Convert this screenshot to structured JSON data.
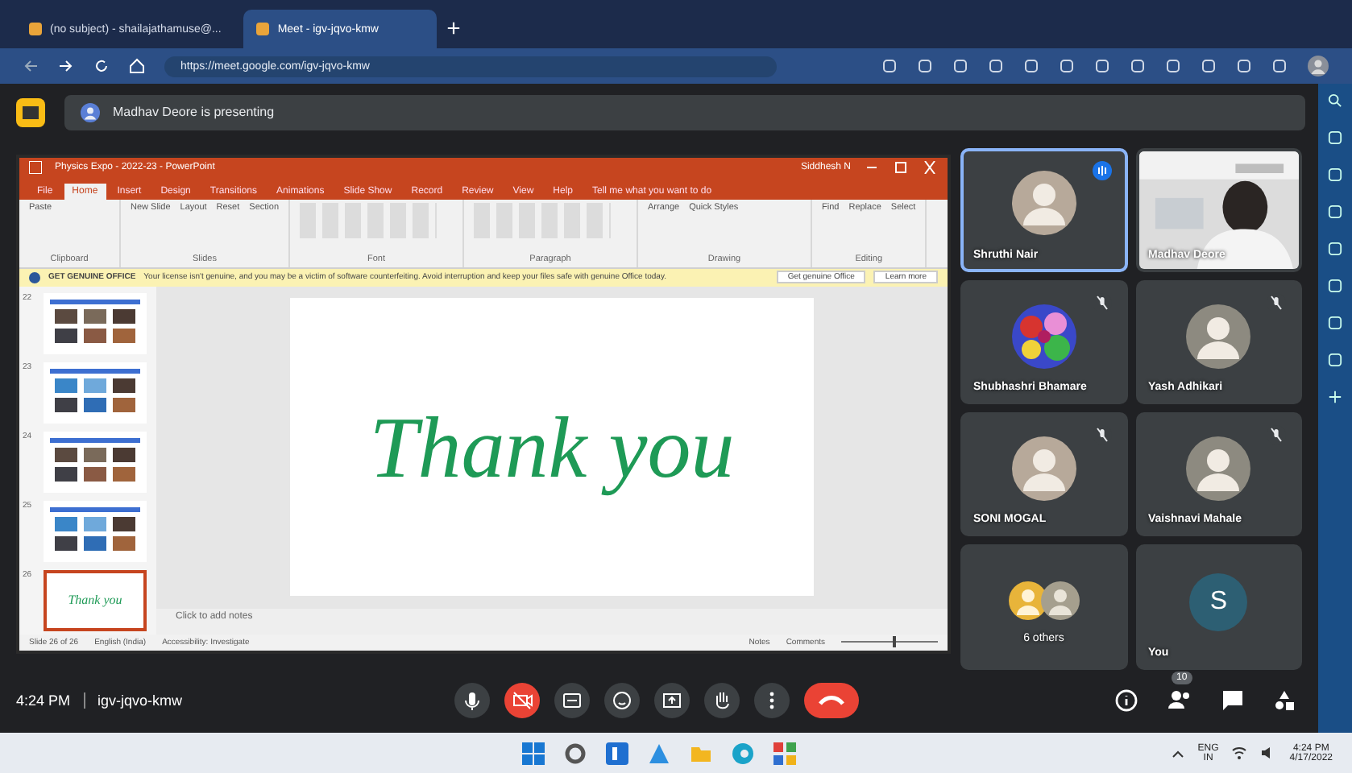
{
  "browser": {
    "tabs": [
      {
        "title": "(no subject) - shailajathamuse@...",
        "selected": false
      },
      {
        "title": "Meet - igv-jqvo-kmw",
        "selected": true
      }
    ],
    "url": "https://meet.google.com/igv-jqvo-kmw"
  },
  "meet": {
    "presenting_banner": "Madhav Deore is presenting",
    "presentation": {
      "title": "Physics Expo - 2022-23 - PowerPoint",
      "account": "Siddhesh N",
      "ribbon_tabs": [
        {
          "label": "File",
          "selected": false
        },
        {
          "label": "Home",
          "selected": true
        },
        {
          "label": "Insert",
          "selected": false
        },
        {
          "label": "Design",
          "selected": false
        },
        {
          "label": "Transitions",
          "selected": false
        },
        {
          "label": "Animations",
          "selected": false
        },
        {
          "label": "Slide Show",
          "selected": false
        },
        {
          "label": "Record",
          "selected": false
        },
        {
          "label": "Review",
          "selected": false
        },
        {
          "label": "View",
          "selected": false
        },
        {
          "label": "Help",
          "selected": false
        }
      ],
      "tell_me": "Tell me what you want to do",
      "ribbon_groups": [
        {
          "label": "Clipboard",
          "commands": [
            "Paste"
          ]
        },
        {
          "label": "Slides",
          "commands": [
            "New Slide",
            "Layout",
            "Reset",
            "Section"
          ]
        },
        {
          "label": "Font"
        },
        {
          "label": "Paragraph"
        },
        {
          "label": "Drawing",
          "commands": [
            "Arrange",
            "Quick Styles"
          ]
        },
        {
          "label": "Editing",
          "commands": [
            "Find",
            "Replace",
            "Select"
          ]
        }
      ],
      "notice": {
        "title": "GET GENUINE OFFICE",
        "message": "Your license isn't genuine, and you may be a victim of software counterfeiting. Avoid interruption and keep your files safe with genuine Office today.",
        "buttons": [
          "Get genuine Office",
          "Learn more"
        ]
      },
      "thumbnails": [
        {
          "number": "22",
          "kind": "picture",
          "selected": false
        },
        {
          "number": "23",
          "kind": "picture",
          "selected": false
        },
        {
          "number": "24",
          "kind": "picture",
          "selected": false
        },
        {
          "number": "25",
          "kind": "picture",
          "selected": false
        },
        {
          "number": "26",
          "kind": "text",
          "text": "Thank you",
          "selected": true
        }
      ],
      "slide_text": "Thank you",
      "notes_placeholder": "Click to add notes",
      "status_left": [
        "Slide 26 of 26",
        "English (India)",
        "Accessibility: Investigate"
      ],
      "status_right": [
        "Notes",
        "Comments"
      ],
      "zoom_slider": {
        "level": 0.55
      }
    },
    "participants": [
      {
        "name": "Shruthi Nair",
        "kind": "avatar",
        "speaking": true,
        "muted": false
      },
      {
        "name": "Madhav Deore",
        "kind": "video",
        "speaking": false,
        "muted": false
      },
      {
        "name": "Shubhashri Bhamare",
        "kind": "picture",
        "speaking": false,
        "muted": true
      },
      {
        "name": "Yash Adhikari",
        "kind": "avatar",
        "speaking": false,
        "muted": true
      },
      {
        "name": "SONI MOGAL",
        "kind": "avatar",
        "speaking": false,
        "muted": true
      },
      {
        "name": "Vaishnavi Mahale",
        "kind": "avatar",
        "speaking": false,
        "muted": true
      },
      {
        "name": "6 others",
        "kind": "group",
        "speaking": false,
        "muted": false
      },
      {
        "name": "You",
        "kind": "initial",
        "initial": "S",
        "speaking": false,
        "muted": false
      }
    ],
    "time": "4:24 PM",
    "meeting_code": "igv-jqvo-kmw",
    "people_count": "10"
  },
  "taskbar": {
    "language": "ENG",
    "region": "IN",
    "time": "4:24 PM",
    "date": "4/17/2022"
  }
}
